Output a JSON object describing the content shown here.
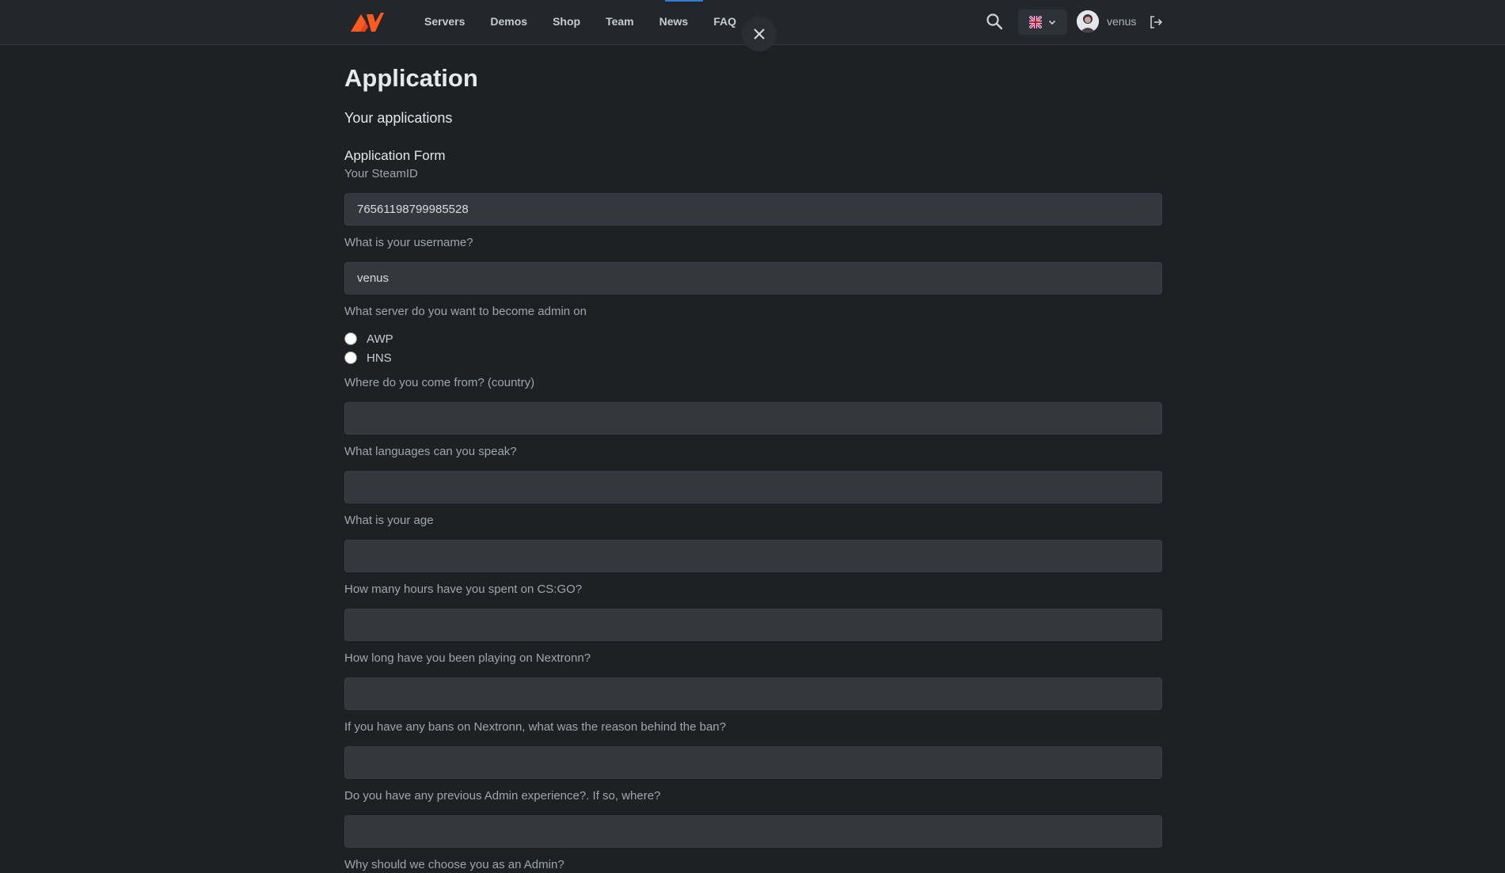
{
  "nav": {
    "items": [
      "Servers",
      "Demos",
      "Shop",
      "Team",
      "News",
      "FAQ"
    ],
    "active": "News"
  },
  "user": {
    "name": "venus"
  },
  "page": {
    "title": "Application",
    "subtitle": "Your applications",
    "form_title": "Application Form"
  },
  "form": {
    "steamid": {
      "label": "Your SteamID",
      "value": "76561198799985528"
    },
    "username": {
      "label": "What is your username?",
      "value": "venus"
    },
    "server": {
      "label": "What server do you want to become admin on",
      "options": [
        "AWP",
        "HNS"
      ]
    },
    "country": {
      "label": "Where do you come from? (country)",
      "value": ""
    },
    "languages": {
      "label": "What languages can you speak?",
      "value": ""
    },
    "age": {
      "label": "What is your age",
      "value": ""
    },
    "hours": {
      "label": "How many hours have you spent on CS:GO?",
      "value": ""
    },
    "playing": {
      "label": "How long have you been playing on Nextronn?",
      "value": ""
    },
    "bans": {
      "label": "If you have any bans on Nextronn, what was the reason behind the ban?",
      "value": ""
    },
    "experience": {
      "label": "Do you have any previous Admin experience?. If so, where?",
      "value": ""
    },
    "why": {
      "label": "Why should we choose you as an Admin?"
    }
  },
  "colors": {
    "accent": "#ff5a1f",
    "background": "#1e2124",
    "input_bg": "#34383e",
    "nav_active": "#2e7dd7"
  }
}
